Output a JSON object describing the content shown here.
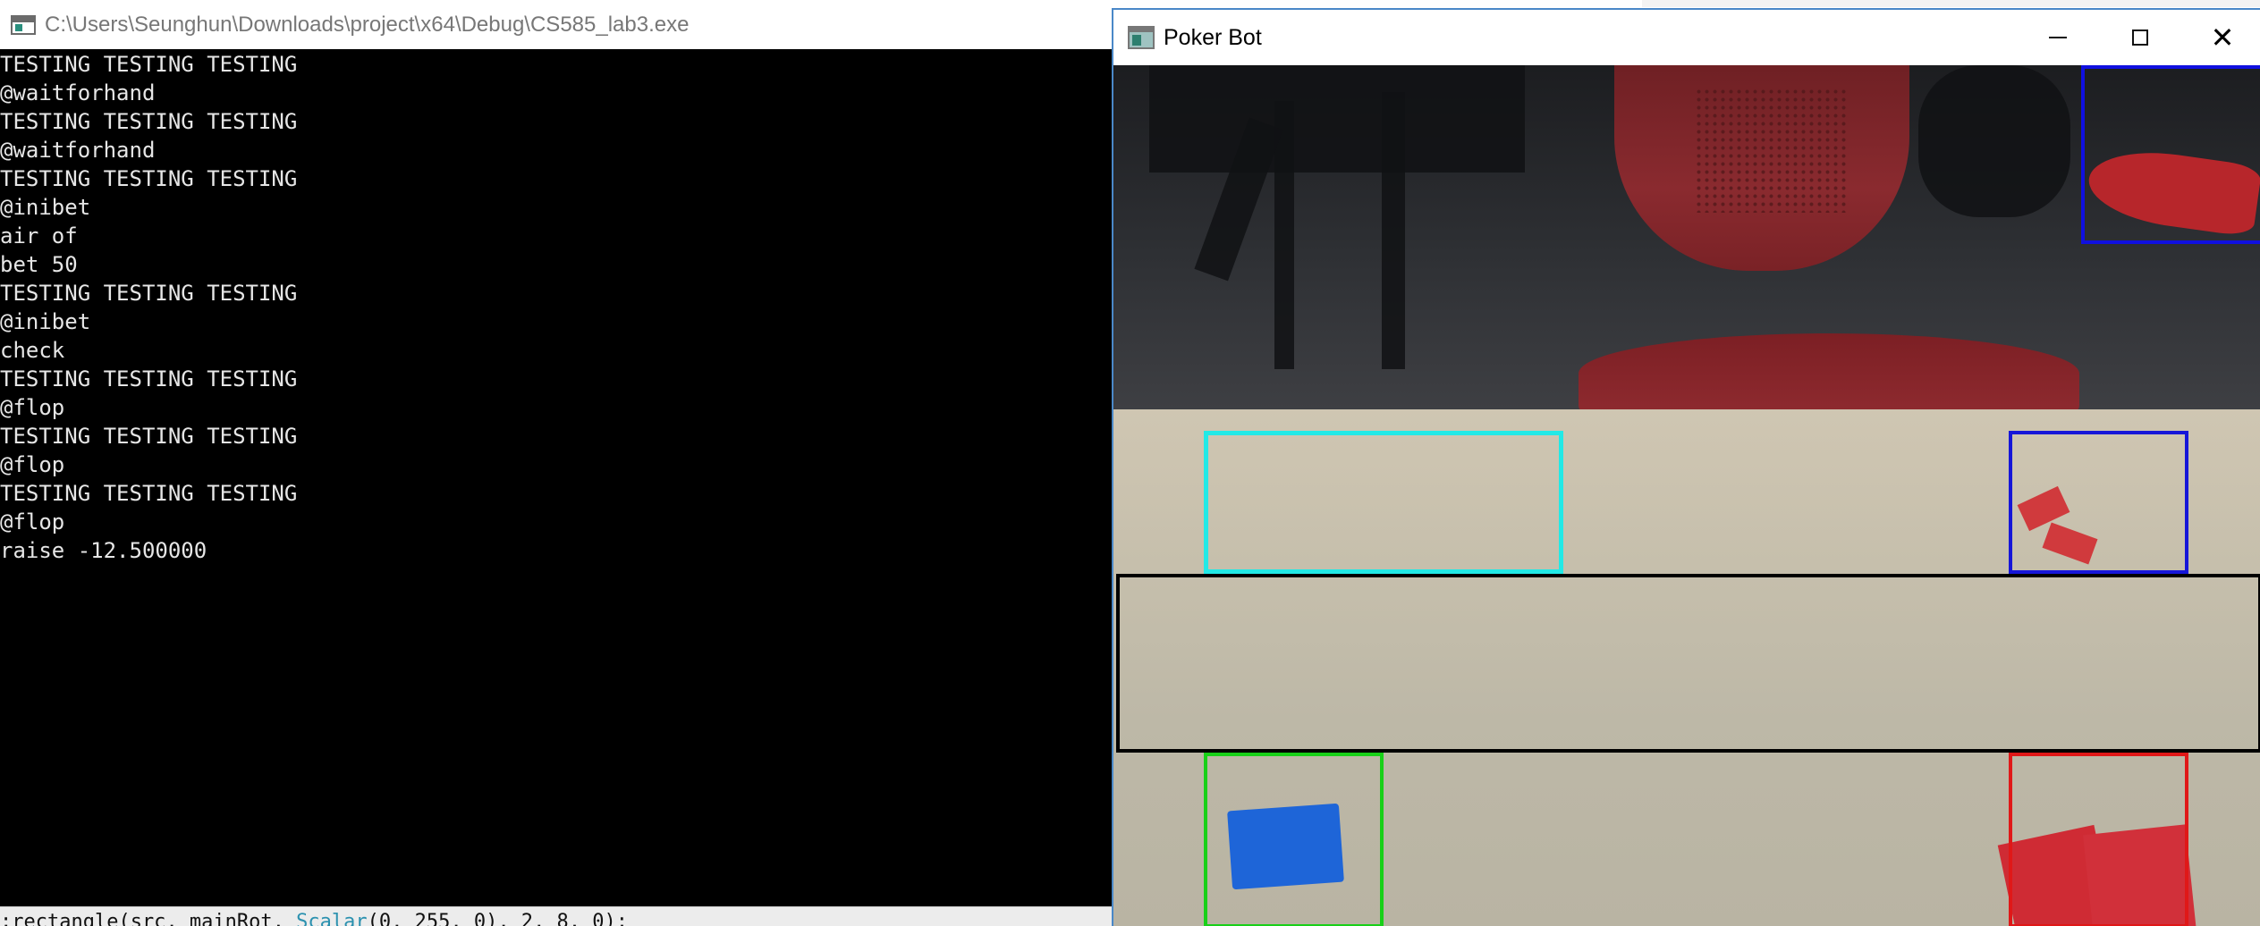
{
  "console": {
    "title": "C:\\Users\\Seunghun\\Downloads\\project\\x64\\Debug\\CS585_lab3.exe",
    "lines": [
      "TESTING TESTING TESTING",
      "@waitforhand",
      "TESTING TESTING TESTING",
      "@waitforhand",
      "TESTING TESTING TESTING",
      "@inibet",
      "air of",
      "bet 50",
      "TESTING TESTING TESTING",
      "@inibet",
      "check",
      "TESTING TESTING TESTING",
      "@flop",
      "TESTING TESTING TESTING",
      "@flop",
      "TESTING TESTING TESTING",
      "@flop",
      "raise -12.500000"
    ],
    "background_code": {
      "prefix": ";rectangle(src, mainRot, ",
      "keyword": "Scalar",
      "suffix": "(0, 255, 0), 2, 8, 0);"
    }
  },
  "pokerbot": {
    "title": "Poker Bot",
    "controls": {
      "minimize": "minimize",
      "maximize": "maximize",
      "close": "✕"
    },
    "camera": {
      "region_colors": {
        "top_right": "#1010e0",
        "cyan": "#22e9e6",
        "blue": "#1616d8",
        "black": "#000000",
        "green": "#18d018",
        "red": "#e01818"
      }
    }
  }
}
